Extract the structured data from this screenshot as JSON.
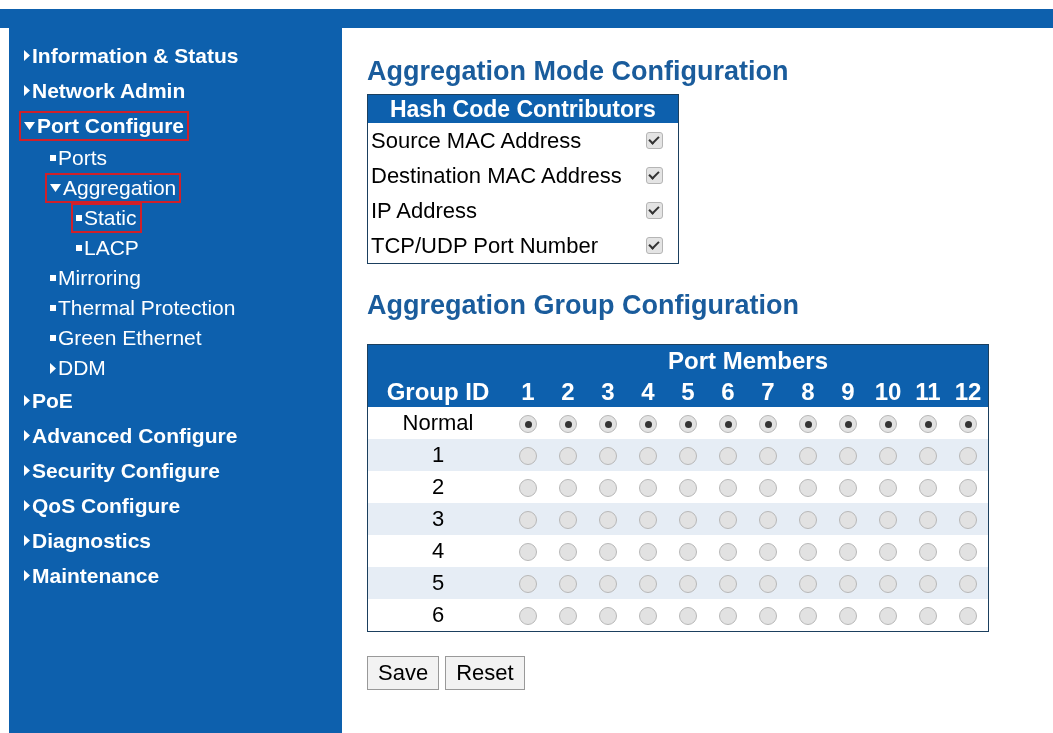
{
  "sidebar": {
    "items": [
      {
        "label": "Information & Status",
        "kind": "folder",
        "expanded": false,
        "highlighted": false
      },
      {
        "label": "Network Admin",
        "kind": "folder",
        "expanded": false,
        "highlighted": false
      },
      {
        "label": "Port Configure",
        "kind": "folder",
        "expanded": true,
        "highlighted": true,
        "children": [
          {
            "label": "Ports",
            "kind": "page",
            "highlighted": false
          },
          {
            "label": "Aggregation",
            "kind": "folder",
            "expanded": true,
            "highlighted": true,
            "children": [
              {
                "label": "Static",
                "kind": "page",
                "highlighted": true
              },
              {
                "label": "LACP",
                "kind": "page",
                "highlighted": false
              }
            ]
          },
          {
            "label": "Mirroring",
            "kind": "page",
            "highlighted": false
          },
          {
            "label": "Thermal Protection",
            "kind": "page",
            "highlighted": false
          },
          {
            "label": "Green Ethernet",
            "kind": "page",
            "highlighted": false
          },
          {
            "label": "DDM",
            "kind": "folder",
            "expanded": false,
            "highlighted": false
          }
        ]
      },
      {
        "label": "PoE",
        "kind": "folder",
        "expanded": false,
        "highlighted": false
      },
      {
        "label": "Advanced Configure",
        "kind": "folder",
        "expanded": false,
        "highlighted": false
      },
      {
        "label": "Security Configure",
        "kind": "folder",
        "expanded": false,
        "highlighted": false
      },
      {
        "label": "QoS Configure",
        "kind": "folder",
        "expanded": false,
        "highlighted": false
      },
      {
        "label": "Diagnostics",
        "kind": "folder",
        "expanded": false,
        "highlighted": false
      },
      {
        "label": "Maintenance",
        "kind": "folder",
        "expanded": false,
        "highlighted": false
      }
    ]
  },
  "mode": {
    "title": "Aggregation Mode Configuration",
    "table_heading": "Hash Code Contributors",
    "rows": [
      {
        "label": "Source MAC Address",
        "checked": true
      },
      {
        "label": "Destination MAC Address",
        "checked": true
      },
      {
        "label": "IP Address",
        "checked": true
      },
      {
        "label": "TCP/UDP Port Number",
        "checked": true
      }
    ]
  },
  "group": {
    "title": "Aggregation Group Configuration",
    "members_heading": "Port Members",
    "id_heading": "Group ID",
    "ports": [
      "1",
      "2",
      "3",
      "4",
      "5",
      "6",
      "7",
      "8",
      "9",
      "10",
      "11",
      "12"
    ],
    "rows": [
      {
        "group_id": "Normal",
        "members": [
          true,
          true,
          true,
          true,
          true,
          true,
          true,
          true,
          true,
          true,
          true,
          true
        ]
      },
      {
        "group_id": "1",
        "members": [
          false,
          false,
          false,
          false,
          false,
          false,
          false,
          false,
          false,
          false,
          false,
          false
        ]
      },
      {
        "group_id": "2",
        "members": [
          false,
          false,
          false,
          false,
          false,
          false,
          false,
          false,
          false,
          false,
          false,
          false
        ]
      },
      {
        "group_id": "3",
        "members": [
          false,
          false,
          false,
          false,
          false,
          false,
          false,
          false,
          false,
          false,
          false,
          false
        ]
      },
      {
        "group_id": "4",
        "members": [
          false,
          false,
          false,
          false,
          false,
          false,
          false,
          false,
          false,
          false,
          false,
          false
        ]
      },
      {
        "group_id": "5",
        "members": [
          false,
          false,
          false,
          false,
          false,
          false,
          false,
          false,
          false,
          false,
          false,
          false
        ]
      },
      {
        "group_id": "6",
        "members": [
          false,
          false,
          false,
          false,
          false,
          false,
          false,
          false,
          false,
          false,
          false,
          false
        ]
      }
    ]
  },
  "buttons": [
    "Save",
    "Reset"
  ]
}
